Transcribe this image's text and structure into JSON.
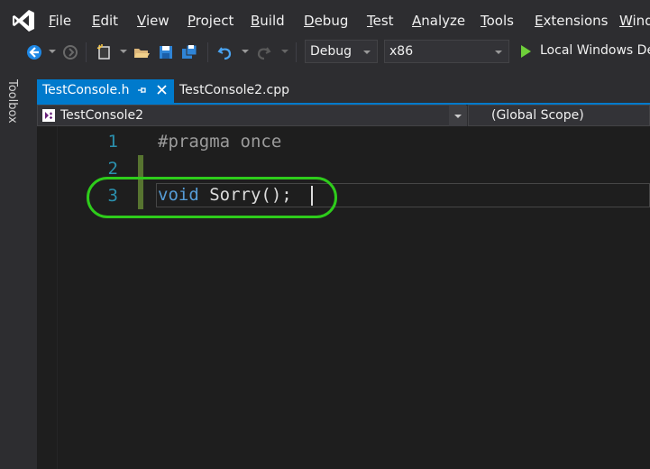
{
  "menu": {
    "items": [
      {
        "accel": "F",
        "rest": "ile"
      },
      {
        "accel": "E",
        "rest": "dit"
      },
      {
        "accel": "V",
        "rest": "iew"
      },
      {
        "accel": "P",
        "rest": "roject"
      },
      {
        "accel": "B",
        "rest": "uild"
      },
      {
        "accel": "D",
        "rest": "ebug"
      },
      {
        "accel": "T",
        "rest": "est"
      },
      {
        "accel": "A",
        "rest": "nalyze"
      },
      {
        "accel": "T",
        "rest": "ools"
      },
      {
        "accel": "E",
        "rest": "xtensions"
      },
      {
        "accel": "W",
        "rest": "ind"
      }
    ]
  },
  "toolbar": {
    "configuration": "Debug",
    "platform": "x86",
    "run_label": "Local Windows De"
  },
  "toolbox": {
    "label": "Toolbox"
  },
  "tabs": [
    {
      "label": "TestConsole.h",
      "active": true
    },
    {
      "label": "TestConsole2.cpp",
      "active": false
    }
  ],
  "navbar": {
    "project": "TestConsole2",
    "scope": "(Global Scope)"
  },
  "editor": {
    "lines": [
      {
        "number": "1",
        "text": "#pragma once"
      },
      {
        "number": "2",
        "text": ""
      },
      {
        "number": "3",
        "keyword": "void",
        "rest": " Sorry();"
      }
    ]
  },
  "colors": {
    "accent": "#007acc",
    "keyword": "#569cd6",
    "line_number": "#2b91af",
    "preprocessor": "#9b9b9b",
    "highlight": "#2ecc1b",
    "change_bar": "#577430"
  },
  "icons": [
    "vs-logo-icon",
    "back-icon",
    "forward-icon",
    "new-project-icon",
    "open-folder-icon",
    "save-icon",
    "save-all-icon",
    "undo-icon",
    "redo-icon",
    "start-icon",
    "pin-icon",
    "close-icon",
    "project-icon"
  ]
}
